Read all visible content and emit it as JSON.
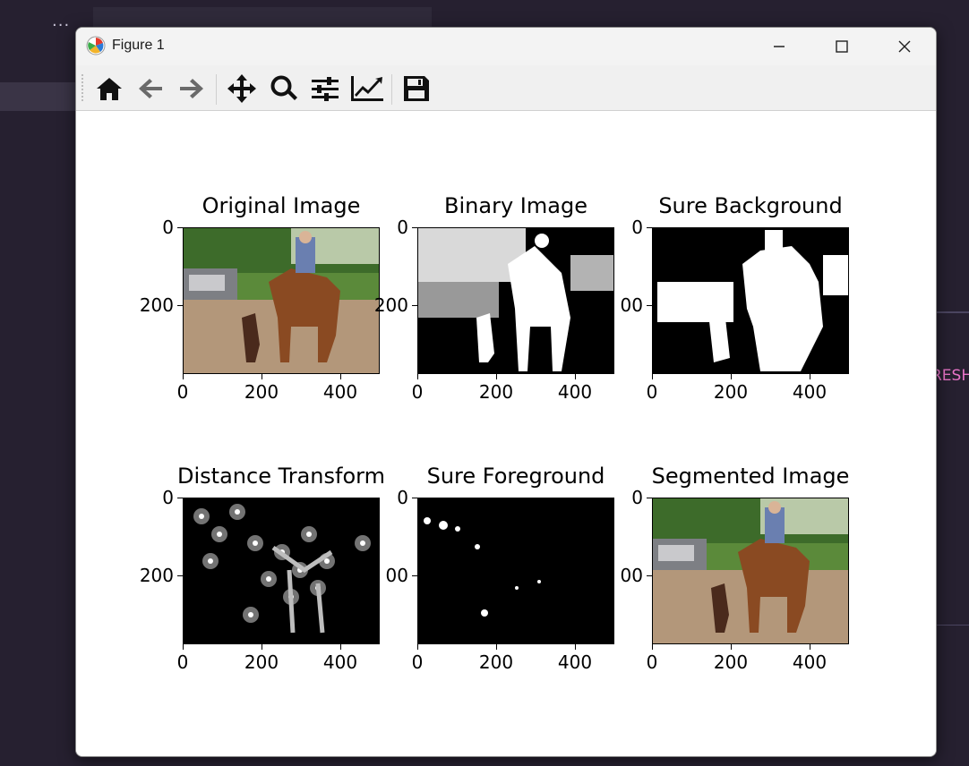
{
  "window": {
    "title": "Figure 1"
  },
  "toolbar": {
    "buttons": [
      "home-icon",
      "back-arrow-icon",
      "forward-arrow-icon",
      "pan-icon",
      "zoom-icon",
      "configure-subplots-icon",
      "edit-axes-icon",
      "save-icon"
    ]
  },
  "subplots": [
    {
      "title": "Original Image",
      "xticks": [
        "0",
        "200",
        "400"
      ],
      "yticks": [
        "0",
        "200"
      ]
    },
    {
      "title": "Binary Image",
      "xticks": [
        "0",
        "200",
        "400"
      ],
      "yticks": [
        "0",
        "200"
      ]
    },
    {
      "title": "Sure Background",
      "xticks": [
        "0",
        "200",
        "400"
      ],
      "yticks": [
        "0",
        "00"
      ]
    },
    {
      "title": "Distance Transform",
      "xticks": [
        "0",
        "200",
        "400"
      ],
      "yticks": [
        "0",
        "200"
      ]
    },
    {
      "title": "Sure Foreground",
      "xticks": [
        "0",
        "200",
        "400"
      ],
      "yticks": [
        "0",
        "00"
      ]
    },
    {
      "title": "Segmented Image",
      "xticks": [
        "0",
        "200",
        "400"
      ],
      "yticks": [
        "0",
        "00"
      ]
    }
  ],
  "background": {
    "right_fragment": "RESH"
  },
  "colors": {
    "accent_pink": "#e874c8",
    "desktop_bg": "#262030"
  }
}
